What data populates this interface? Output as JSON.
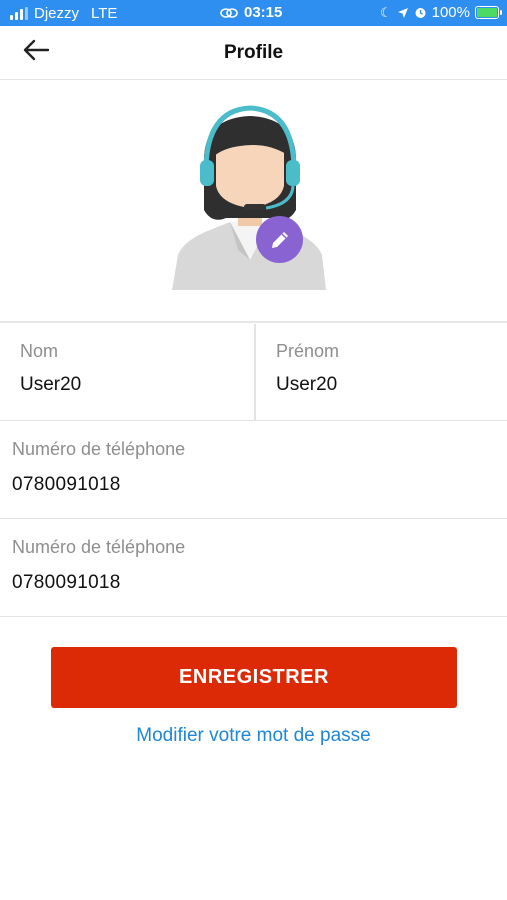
{
  "status_bar": {
    "carrier": "Djezzy",
    "network": "LTE",
    "time": "03:15",
    "battery": "100%",
    "bg_color": "#2f8ff0"
  },
  "header": {
    "title": "Profile",
    "back_icon": "arrow-left-icon"
  },
  "profile": {
    "avatar_icon": "support-agent-avatar",
    "edit_icon": "pencil-icon",
    "edit_color": "#8a63d2"
  },
  "fields": {
    "nom": {
      "label": "Nom",
      "value": "User20"
    },
    "prenom": {
      "label": "Prénom",
      "value": "User20"
    },
    "phone_1": {
      "label": "Numéro de téléphone",
      "value": "0780091018"
    },
    "phone_2": {
      "label": "Numéro de téléphone",
      "value": "0780091018"
    }
  },
  "actions": {
    "save_label": "ENREGISTRER",
    "save_color": "#dc2a07",
    "change_password_label": "Modifier votre mot de passe",
    "link_color": "#1f86d8"
  }
}
